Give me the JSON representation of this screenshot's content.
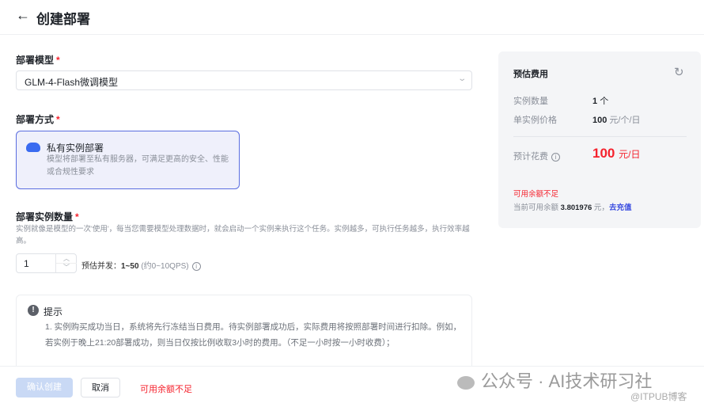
{
  "header": {
    "back_icon": "arrow-left-icon",
    "title": "创建部署"
  },
  "model": {
    "label": "部署模型",
    "required": "*",
    "value": "GLM-4-Flash微调模型"
  },
  "method": {
    "label": "部署方式",
    "required": "*",
    "card_title": "私有实例部署",
    "card_desc": "模型将部署至私有服务器，可满足更高的安全、性能或合规性要求"
  },
  "instances": {
    "label": "部署实例数量",
    "required": "*",
    "desc": "实例就像是模型的一次'使用'，每当您需要模型处理数据时，就会启动一个实例来执行这个任务。实例越多，可执行任务越多，执行效率越高。",
    "value": "1",
    "concurrency_label": "预估并发：",
    "concurrency_value": "1~50",
    "concurrency_qps": "(约0~10QPS)"
  },
  "tip": {
    "title": "提示",
    "text": "1. 实例购买成功当日，系统将先行冻结当日费用。待实例部署成功后，实际费用将按照部署时间进行扣除。例如，若实例于晚上21:20部署成功，则当日仅按比例收取3小时的费用。（不足一小时按一小时收费）；"
  },
  "footer": {
    "confirm": "确认创建",
    "cancel": "取消",
    "warning": "可用余额不足"
  },
  "cost": {
    "title": "预估费用",
    "count_label": "实例数量",
    "count_value": "1",
    "count_unit": "个",
    "price_label": "单实例价格",
    "price_value": "100",
    "price_unit": "元/个/日",
    "total_label": "预计花费",
    "total_value": "100",
    "total_unit": "元/日",
    "balance_warning": "可用余额不足",
    "balance_prefix": "当前可用余额",
    "balance_value": "3.801976",
    "balance_suffix": "元，",
    "recharge": "去充值"
  },
  "watermark": {
    "text": "公众号 · AI技术研习社",
    "sub": "@ITPUB博客"
  }
}
